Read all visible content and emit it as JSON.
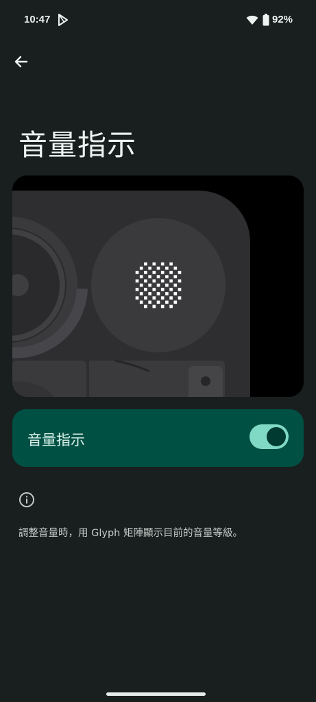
{
  "status_bar": {
    "time": "10:47",
    "play_icon": "play-store-icon",
    "wifi_icon": "wifi-icon",
    "battery_icon": "battery-icon",
    "battery": "92%"
  },
  "header": {
    "back_icon": "arrow-back-icon",
    "title": "音量指示"
  },
  "preview": {
    "description_icon": "glyph-matrix-illustration"
  },
  "toggle": {
    "label": "音量指示",
    "checked": true,
    "accent": "#7fd9c4",
    "card_color": "#005044"
  },
  "info": {
    "icon": "info-icon",
    "text": "調整音量時，用 Glyph 矩陣顯示目前的音量等級。"
  },
  "colors": {
    "background": "#191f1f",
    "text": "#eef2f0"
  }
}
